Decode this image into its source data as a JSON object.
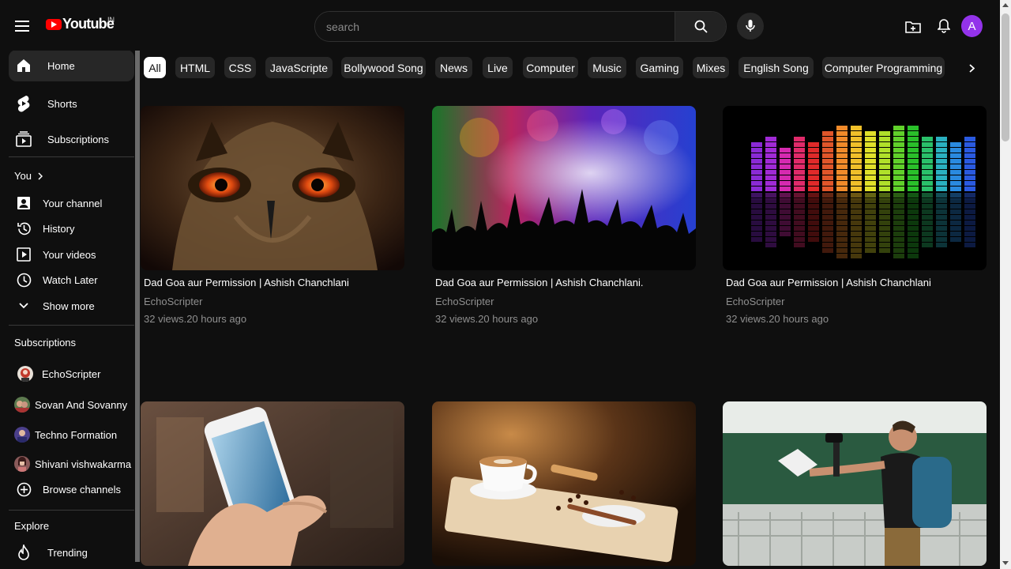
{
  "header": {
    "logo_text": "Youtube",
    "region": "IN",
    "search_placeholder": "search",
    "avatar_letter": "A"
  },
  "sidebar": {
    "main_items": [
      {
        "label": "Home",
        "icon": "home-icon",
        "active": true
      },
      {
        "label": "Shorts",
        "icon": "shorts-icon"
      },
      {
        "label": "Subscriptions",
        "icon": "subscriptions-icon"
      }
    ],
    "you_label": "You",
    "you_items": [
      {
        "label": "Your channel",
        "icon": "account-box-icon"
      },
      {
        "label": "History",
        "icon": "history-icon"
      },
      {
        "label": "Your videos",
        "icon": "play-square-icon"
      },
      {
        "label": "Watch Later",
        "icon": "clock-icon"
      },
      {
        "label": "Show more",
        "icon": "chevron-down-icon"
      }
    ],
    "subscriptions_label": "Subscriptions",
    "subscriptions": [
      {
        "label": "EchoScripter"
      },
      {
        "label": "Sovan And Sovanny"
      },
      {
        "label": "Techno Formation"
      },
      {
        "label": "Shivani vishwakarma"
      }
    ],
    "browse_channels": "Browse channels",
    "explore_label": "Explore",
    "explore_items": [
      {
        "label": "Trending",
        "icon": "fire-icon"
      }
    ]
  },
  "chips": [
    "All",
    "HTML",
    "CSS",
    "JavaScripte",
    "Bollywood Song",
    "News",
    "Live",
    "Computer",
    "Music",
    "Gaming",
    "Mixes",
    "English Song",
    "Computer Programming"
  ],
  "videos": [
    {
      "title": "Dad Goa aur Permission | Ashish Chanchlani",
      "channel": "EchoScripter",
      "meta": "32 views.20 hours ago"
    },
    {
      "title": "Dad Goa aur Permission | Ashish Chanchlani.",
      "channel": "EchoScripter",
      "meta": "32 views.20 hours ago"
    },
    {
      "title": "Dad Goa aur Permission | Ashish Chanchlani",
      "channel": "EchoScripter",
      "meta": "32 views.20 hours ago"
    }
  ],
  "colors": {
    "background": "#0f0f0f",
    "accent_red": "#ff0000",
    "avatar": "#9333ea",
    "chip": "#272727"
  }
}
